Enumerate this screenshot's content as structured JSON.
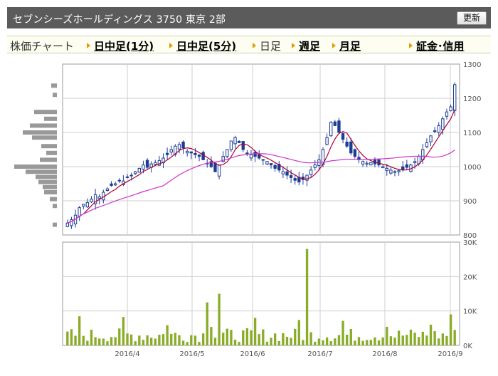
{
  "header": {
    "title": "セブンシーズホールディングス 3750 東京 2部",
    "refresh_label": "更新"
  },
  "tabs": [
    {
      "label": "株価チャート",
      "type": "current"
    },
    {
      "label": "日中足(1分)",
      "type": "link"
    },
    {
      "label": "日中足(5分)",
      "type": "link"
    },
    {
      "label": "日足",
      "type": "current"
    },
    {
      "label": "週足",
      "type": "link"
    },
    {
      "label": "月足",
      "type": "link"
    },
    {
      "label": "証金･信用",
      "type": "link"
    }
  ],
  "colors": {
    "up": "#ffffff",
    "down": "#1b3d95",
    "ma_short": "#b00030",
    "ma_long": "#cc33cc",
    "volume": "#8aac2a",
    "profile": "#999999",
    "grid": "#cfcfcf"
  },
  "chart_data": [
    {
      "type": "candlestick",
      "title": "",
      "y_ticks": [
        800,
        900,
        1000,
        1100,
        1200,
        1300
      ],
      "ylim": [
        800,
        1300
      ],
      "x_ticks": [
        "2016/4",
        "2016/5",
        "2016/6",
        "2016/7",
        "2016/8",
        "2016/9"
      ],
      "grid": true,
      "series_close": [
        835,
        845,
        858,
        880,
        890,
        895,
        905,
        918,
        912,
        925,
        935,
        945,
        950,
        960,
        958,
        970,
        975,
        985,
        995,
        1005,
        998,
        1008,
        1012,
        1018,
        1025,
        1035,
        1050,
        1060,
        1065,
        1055,
        1045,
        1040,
        1035,
        1030,
        1020,
        1010,
        1000,
        985,
        1005,
        1030,
        1050,
        1075,
        1085,
        1070,
        1050,
        1040,
        1035,
        1030,
        1025,
        1020,
        1015,
        1005,
        995,
        990,
        985,
        975,
        968,
        960,
        955,
        962,
        975,
        990,
        1005,
        1020,
        1050,
        1085,
        1130,
        1120,
        1100,
        1080,
        1060,
        1040,
        1030,
        1020,
        1015,
        1010,
        1012,
        1008,
        1005,
        1000,
        995,
        990,
        985,
        988,
        992,
        998,
        1005,
        1015,
        1030,
        1050,
        1070,
        1090,
        1105,
        1120,
        1140,
        1160,
        1175,
        1240
      ]
    },
    {
      "type": "bar",
      "title": "",
      "y_ticks": [
        "0K",
        "10K",
        "20K",
        "30K"
      ],
      "ylim": [
        0,
        30000
      ]
    }
  ]
}
